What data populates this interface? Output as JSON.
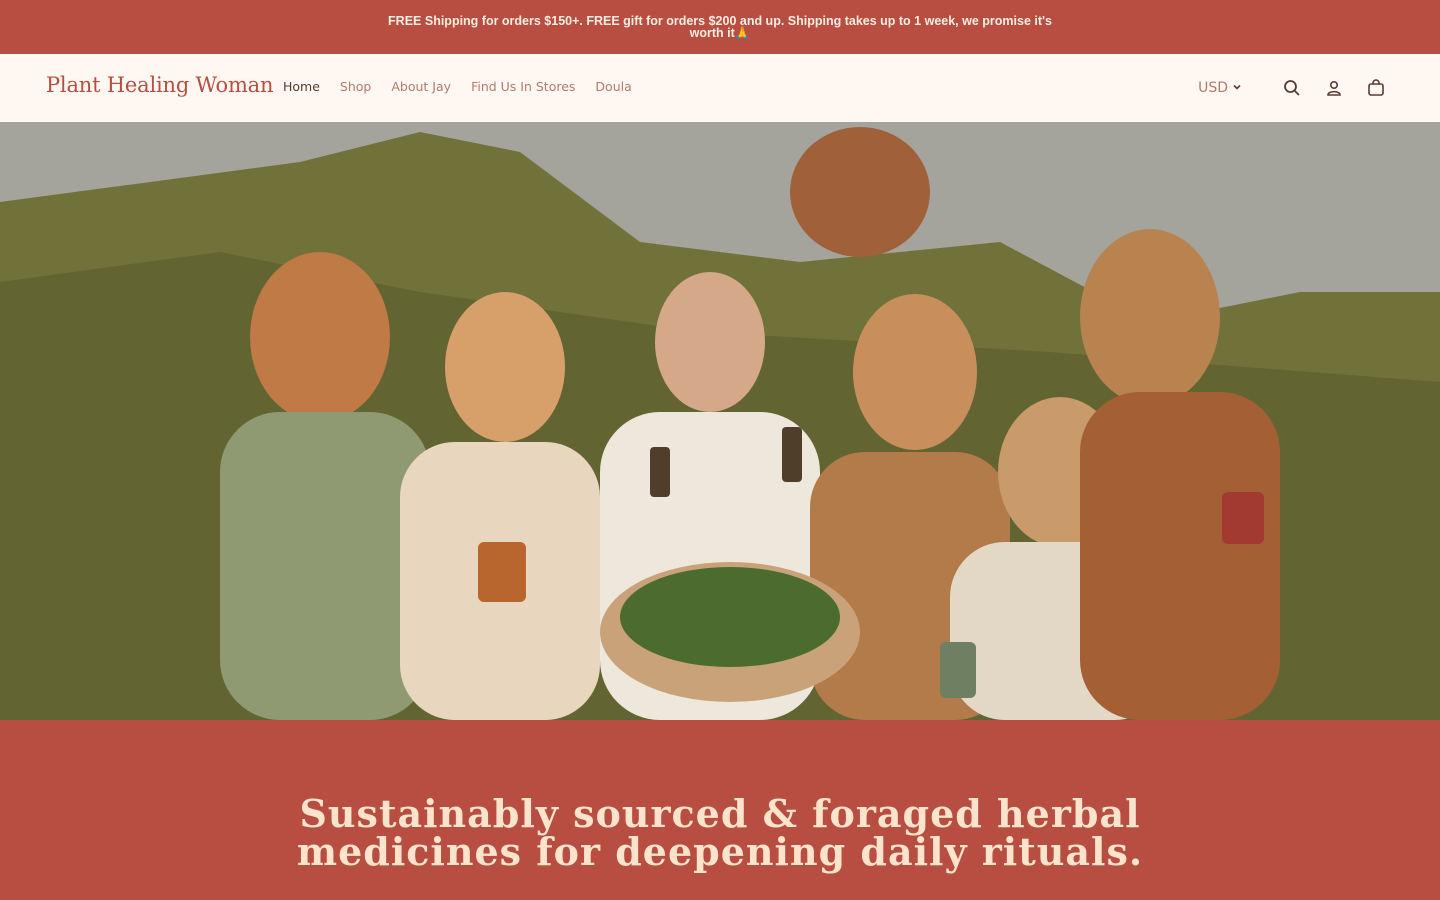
{
  "announcement": {
    "text": "FREE Shipping for orders $150+. FREE gift for orders $200 and up. Shipping takes up to 1 week, we promise it's worth it🙏"
  },
  "header": {
    "logo": "Plant Healing Woman",
    "nav": [
      {
        "label": "Home",
        "active": true
      },
      {
        "label": "Shop",
        "active": false
      },
      {
        "label": "About Jay",
        "active": false
      },
      {
        "label": "Find Us In Stores",
        "active": false
      },
      {
        "label": "Doula",
        "active": false
      }
    ],
    "currency": "USD",
    "icons": [
      "search-icon",
      "account-icon",
      "cart-icon"
    ]
  },
  "hero": {
    "image_alt": "Group of women holding herbal products outdoors"
  },
  "tagline": {
    "text": "Sustainably sourced & foraged herbal medicines for deepening daily rituals."
  },
  "colors": {
    "brand": "#b74e41",
    "header_bg": "#fff8f2",
    "nav_text": "#b07a6d",
    "tagline_text": "#fbe3cc"
  }
}
